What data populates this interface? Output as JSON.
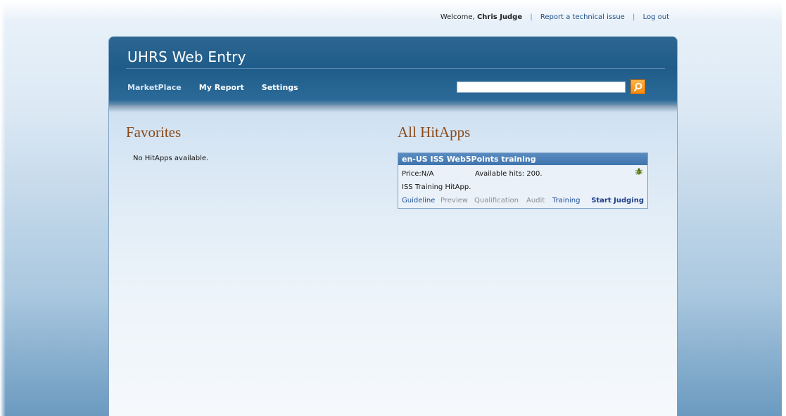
{
  "topbar": {
    "welcome_prefix": "Welcome,",
    "user_name": "Chris Judge",
    "separator": "|",
    "report_link": "Report a technical issue",
    "logout_link": "Log out"
  },
  "header": {
    "app_title": "UHRS Web Entry",
    "nav": [
      {
        "label": "MarketPlace"
      },
      {
        "label": "My Report"
      },
      {
        "label": "Settings"
      }
    ],
    "search": {
      "value": "",
      "placeholder": "",
      "icon": "search-icon"
    }
  },
  "favorites": {
    "title": "Favorites",
    "empty_message": "No HitApps available."
  },
  "all_hitapps": {
    "title": "All HitApps",
    "cards": [
      {
        "title": "en-US ISS Web5Points training",
        "price": "Price:N/A",
        "available_hits": "Available hits: 200.",
        "description": "ISS Training HitApp.",
        "status_icon": "bug-icon",
        "actions": {
          "guideline": "Guideline",
          "preview": "Preview",
          "qualification": "Qualification",
          "audit": "Audit",
          "training": "Training",
          "start": "Start Judging"
        }
      }
    ]
  },
  "colors": {
    "header_blue": "#1f5c8a",
    "section_title": "#8a4a18",
    "card_header": "#3f74ad",
    "search_button": "#f28a10",
    "link": "#1f4f98"
  }
}
